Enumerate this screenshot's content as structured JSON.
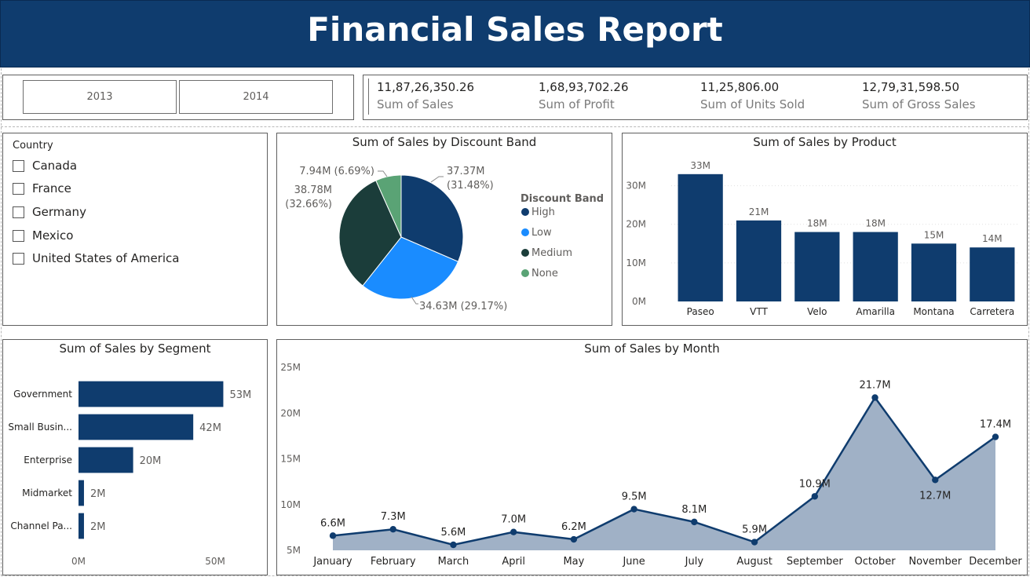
{
  "header": {
    "title": "Financial Sales Report"
  },
  "year_slicer": {
    "options": [
      "2013",
      "2014"
    ]
  },
  "kpis": [
    {
      "value": "11,87,26,350.26",
      "label": "Sum of Sales"
    },
    {
      "value": "1,68,93,702.26",
      "label": "Sum of Profit"
    },
    {
      "value": "11,25,806.00",
      "label": "Sum of Units Sold"
    },
    {
      "value": "12,79,31,598.50",
      "label": "Sum of Gross Sales"
    }
  ],
  "country_slicer": {
    "title": "Country",
    "items": [
      "Canada",
      "France",
      "Germany",
      "Mexico",
      "United States of America"
    ]
  },
  "colors": {
    "navy": "#0f3c6e",
    "blue": "#1a8cff",
    "darkgreen": "#1b3d3a",
    "green": "#5aa375",
    "area": "#a0b1c6"
  },
  "chart_data": [
    {
      "type": "pie",
      "title": "Sum of Sales by Discount Band",
      "legend_title": "Discount Band",
      "legend_position": "right",
      "slices": [
        {
          "name": "High",
          "value": 37.37,
          "label": "37.37M\n(31.48%)",
          "color": "#0f3c6e"
        },
        {
          "name": "Low",
          "value": 34.63,
          "label": "34.63M (29.17%)",
          "color": "#1a8cff"
        },
        {
          "name": "Medium",
          "value": 38.78,
          "label": "38.78M\n(32.66%)",
          "color": "#1b3d3a"
        },
        {
          "name": "None",
          "value": 7.94,
          "label": "7.94M (6.69%)",
          "color": "#5aa375"
        }
      ]
    },
    {
      "type": "bar",
      "title": "Sum of Sales by Product",
      "categories": [
        "Paseo",
        "VTT",
        "Velo",
        "Amarilla",
        "Montana",
        "Carretera"
      ],
      "values": [
        33,
        21,
        18,
        18,
        15,
        14
      ],
      "labels": [
        "33M",
        "21M",
        "18M",
        "18M",
        "15M",
        "14M"
      ],
      "ylim": [
        0,
        35
      ],
      "yticks": [
        0,
        10,
        20,
        30
      ],
      "ytick_labels": [
        "0M",
        "10M",
        "20M",
        "30M"
      ],
      "grid": true
    },
    {
      "type": "bar",
      "orientation": "horizontal",
      "title": "Sum of Sales by Segment",
      "categories": [
        "Government",
        "Small Busin...",
        "Enterprise",
        "Midmarket",
        "Channel Pa..."
      ],
      "values": [
        53,
        42,
        20,
        2,
        2
      ],
      "labels": [
        "53M",
        "42M",
        "20M",
        "2M",
        "2M"
      ],
      "xlim": [
        0,
        60
      ],
      "xticks": [
        0,
        50
      ],
      "xtick_labels": [
        "0M",
        "50M"
      ]
    },
    {
      "type": "area",
      "title": "Sum of Sales by Month",
      "categories": [
        "January",
        "February",
        "March",
        "April",
        "May",
        "June",
        "July",
        "August",
        "September",
        "October",
        "November",
        "December"
      ],
      "values": [
        6.6,
        7.3,
        5.6,
        7.0,
        6.2,
        9.5,
        8.1,
        5.9,
        10.9,
        21.7,
        12.7,
        17.4
      ],
      "labels": [
        "6.6M",
        "7.3M",
        "5.6M",
        "7.0M",
        "6.2M",
        "9.5M",
        "8.1M",
        "5.9M",
        "10.9M",
        "21.7M",
        "12.7M",
        "17.4M"
      ],
      "ylim": [
        5,
        25
      ],
      "yticks": [
        5,
        10,
        15,
        20,
        25
      ],
      "ytick_labels": [
        "5M",
        "10M",
        "15M",
        "20M",
        "25M"
      ]
    }
  ]
}
